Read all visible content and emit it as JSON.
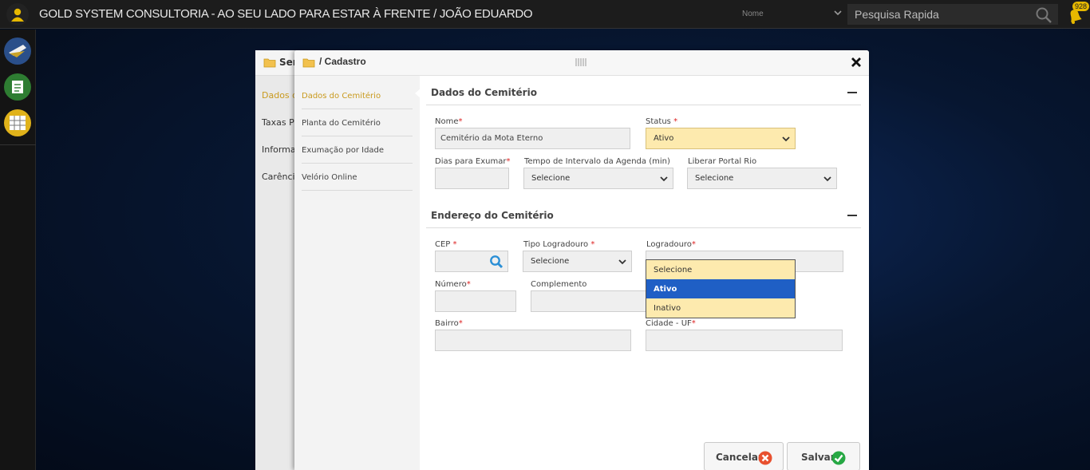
{
  "topbar": {
    "title": "GOLD SYSTEM CONSULTORIA - AO SEU LADO PARA ESTAR À FRENTE / JOÃO EDUARDO",
    "search_field_label": "Nome",
    "search_placeholder": "Pesquisa Rapida",
    "notification_count": "928"
  },
  "back_dialog": {
    "title": "Ser",
    "items": [
      "Dados d",
      "Taxas Po",
      "Informa",
      "Carência"
    ]
  },
  "dialog": {
    "title": "/ Cadastro",
    "nav": [
      {
        "label": "Dados do Cemitério"
      },
      {
        "label": "Planta do Cemitério"
      },
      {
        "label": "Exumação por Idade"
      },
      {
        "label": "Velório Online"
      }
    ],
    "section1": {
      "title": "Dados do Cemitério",
      "nome_label": "Nome",
      "nome_value": "Cemitério da Mota Eterno",
      "status_label": "Status",
      "status_value": "Ativo",
      "dias_label": "Dias para Exumar",
      "tempo_label": "Tempo de Intervalo da Agenda (min)",
      "tempo_value": "Selecione",
      "liberar_label": "Liberar Portal Rio",
      "liberar_value": "Selecione"
    },
    "section2": {
      "title": "Endereço do Cemitério",
      "cep_label": "CEP",
      "tipo_label": "Tipo Logradouro",
      "tipo_value": "Selecione",
      "logradouro_label": "Logradouro",
      "numero_label": "Número",
      "complemento_label": "Complemento",
      "bairro_label": "Bairro",
      "cidade_label": "Cidade - UF"
    },
    "status_dropdown": {
      "options": [
        "Selecione",
        "Ativo",
        "Inativo"
      ],
      "highlighted": "Ativo"
    },
    "buttons": {
      "cancel": "Cancelar",
      "save": "Salvar"
    },
    "required_mark": "*"
  }
}
